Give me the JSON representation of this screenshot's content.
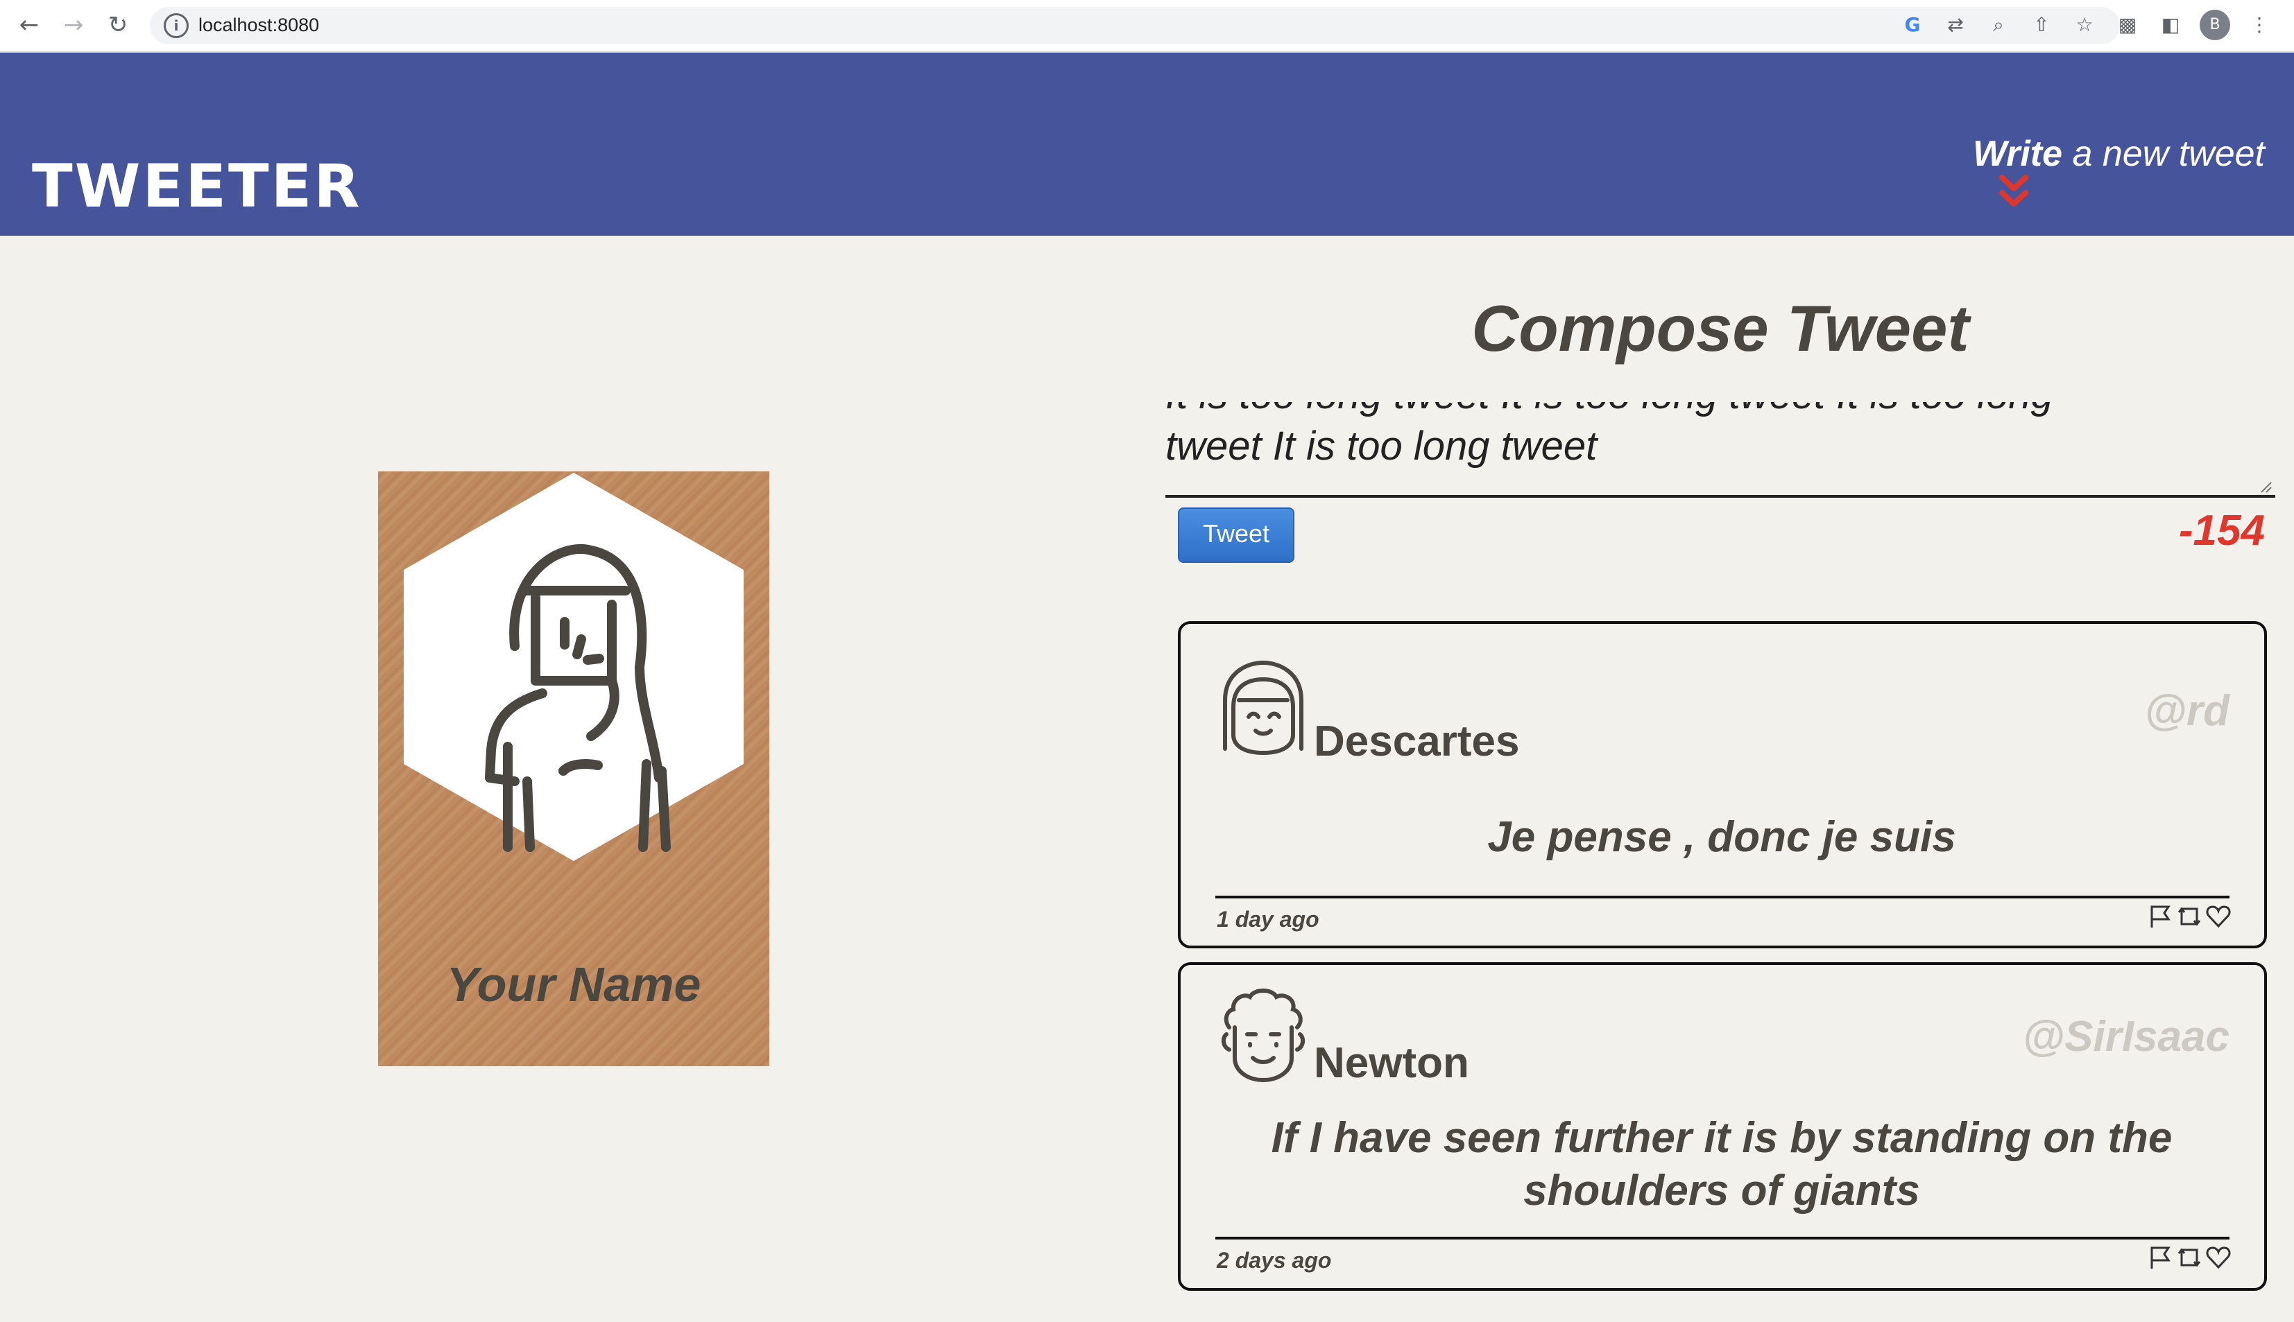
{
  "browser": {
    "url": "localhost:8080",
    "profile_initial": "B",
    "icons": [
      "back-icon",
      "forward-icon",
      "reload-icon",
      "info-icon",
      "google-icon",
      "translate-icon",
      "zoom-icon",
      "share-icon",
      "star-icon",
      "extensions-icon",
      "sidepanel-icon",
      "profile-avatar",
      "menu-icon"
    ]
  },
  "header": {
    "logo": "TWEETER",
    "write_bold": "Write",
    "write_rest": " a new tweet",
    "colors": {
      "background": "#46549b",
      "arrow": "#e0362c"
    }
  },
  "profile": {
    "name": "Your Name"
  },
  "compose": {
    "title": "Compose Tweet",
    "text_visible_line": "tweet It is too long tweet",
    "text_cut_line": "It is too long tweet It is too long tweet It is too long",
    "tweet_button": "Tweet",
    "counter": "-154"
  },
  "tweets": [
    {
      "name": "Descartes",
      "handle": "@rd",
      "content": "Je pense , donc je suis",
      "date": "1 day ago"
    },
    {
      "name": "Newton",
      "handle": "@SirIsaac",
      "content": "If I have seen further it is by standing on the shoulders of giants",
      "date": "2 days ago"
    }
  ]
}
